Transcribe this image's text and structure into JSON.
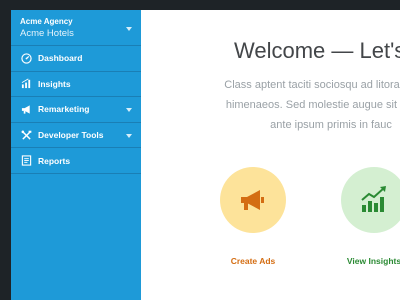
{
  "account": {
    "agency": "Acme Agency",
    "client": "Acme Hotels",
    "icon": "chevron-down-icon"
  },
  "sidebar": {
    "items": [
      {
        "label": "Dashboard",
        "icon": "dashboard-gauge-icon",
        "has_submenu": false
      },
      {
        "label": "Insights",
        "icon": "bar-chart-icon",
        "has_submenu": false
      },
      {
        "label": "Remarketing",
        "icon": "megaphone-icon",
        "has_submenu": true
      },
      {
        "label": "Developer Tools",
        "icon": "tools-icon",
        "has_submenu": true
      },
      {
        "label": "Reports",
        "icon": "report-icon",
        "has_submenu": false
      }
    ]
  },
  "main": {
    "title": "Welcome — Let's",
    "intro_lines": [
      "Class aptent taciti sociosqu ad litora torquer",
      "himenaeos. Sed molestie augue sit amet le",
      "ante ipsum primis in fauc"
    ],
    "actions": [
      {
        "label": "Create Ads",
        "icon": "megaphone-icon",
        "circle_color": "#fde39a",
        "label_color": "#d46d12"
      },
      {
        "label": "View Insights",
        "icon": "growth-chart-icon",
        "circle_color": "#d4efd1",
        "label_color": "#2a8a33"
      }
    ]
  },
  "colors": {
    "sidebar": "#1e9ad8",
    "background": "#1e2327",
    "title": "#434649",
    "body_text": "#9aa1a6"
  }
}
